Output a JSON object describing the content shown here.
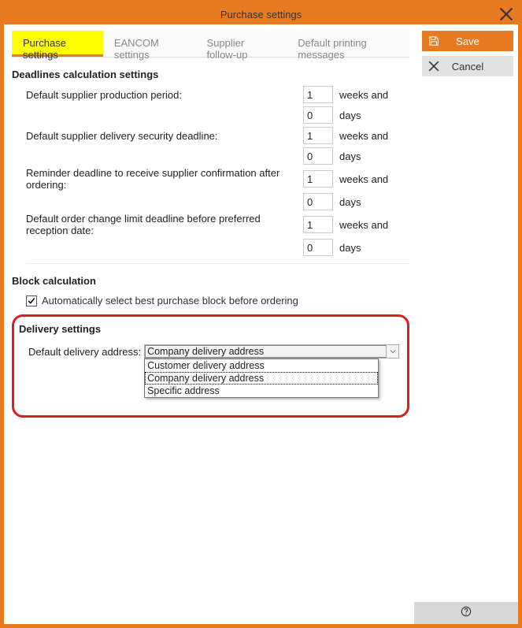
{
  "title": "Purchase settings",
  "tabs": [
    {
      "label": "Purchase settings"
    },
    {
      "label": "EANCOM settings"
    },
    {
      "label": "Supplier follow-up"
    },
    {
      "label": "Default printing messages"
    }
  ],
  "actions": {
    "save": "Save",
    "cancel": "Cancel"
  },
  "deadlines": {
    "heading": "Deadlines calculation settings",
    "items": [
      {
        "label": "Default supplier production period:",
        "weeks": "1",
        "days": "0"
      },
      {
        "label": "Default supplier delivery security deadline:",
        "weeks": "1",
        "days": "0"
      },
      {
        "label": "Reminder deadline to receive supplier confirmation after ordering:",
        "weeks": "1",
        "days": "0"
      },
      {
        "label": "Default order change limit deadline before preferred reception date:",
        "weeks": "1",
        "days": "0"
      }
    ],
    "unit_weeks": "weeks and",
    "unit_days": "days"
  },
  "block": {
    "heading": "Block calculation",
    "checkbox_label": "Automatically select best purchase block before ordering",
    "checked": true
  },
  "delivery": {
    "heading": "Delivery settings",
    "label": "Default delivery address:",
    "selected": "Company delivery address",
    "options": [
      "Customer delivery address",
      "Company delivery address",
      "Specific address"
    ]
  }
}
